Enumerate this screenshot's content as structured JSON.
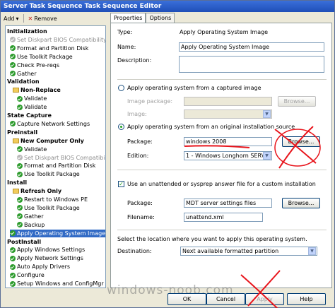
{
  "window": {
    "title": "Server Task Sequence Task Sequence Editor"
  },
  "toolbar": {
    "add_label": "Add",
    "remove_label": "Remove"
  },
  "tree": [
    {
      "label": "Initialization",
      "kind": "group"
    },
    {
      "label": "Set Diskpart BIOS Compatibility",
      "kind": "item",
      "disabled": true
    },
    {
      "label": "Format and Partition Disk",
      "kind": "item"
    },
    {
      "label": "Use Toolkit Package",
      "kind": "item"
    },
    {
      "label": "Check Pre-reqs",
      "kind": "item"
    },
    {
      "label": "Gather",
      "kind": "item"
    },
    {
      "label": "Validation",
      "kind": "group"
    },
    {
      "label": "Non-Replace",
      "kind": "subgroup"
    },
    {
      "label": "Validate",
      "kind": "item2"
    },
    {
      "label": "Validate",
      "kind": "item2"
    },
    {
      "label": "State Capture",
      "kind": "group"
    },
    {
      "label": "Capture Network Settings",
      "kind": "item"
    },
    {
      "label": "Preinstall",
      "kind": "group"
    },
    {
      "label": "New Computer Only",
      "kind": "subgroup"
    },
    {
      "label": "Validate",
      "kind": "item2"
    },
    {
      "label": "Set Diskpart BIOS Compatibi",
      "kind": "item2",
      "disabled": true
    },
    {
      "label": "Format and Partition Disk",
      "kind": "item2"
    },
    {
      "label": "Use Toolkit Package",
      "kind": "item2"
    },
    {
      "label": "Install",
      "kind": "group"
    },
    {
      "label": "Refresh Only",
      "kind": "subgroup"
    },
    {
      "label": "Restart to Windows PE",
      "kind": "item2"
    },
    {
      "label": "Use Toolkit Package",
      "kind": "item2"
    },
    {
      "label": "Gather",
      "kind": "item2"
    },
    {
      "label": "Backup",
      "kind": "item2"
    },
    {
      "label": "Apply Operating System Image",
      "kind": "item",
      "selected": true
    },
    {
      "label": "PostInstall",
      "kind": "group"
    },
    {
      "label": "Apply Windows Settings",
      "kind": "item"
    },
    {
      "label": "Apply Network Settings",
      "kind": "item"
    },
    {
      "label": "Auto Apply Drivers",
      "kind": "item"
    },
    {
      "label": "Configure",
      "kind": "item"
    },
    {
      "label": "Setup Windows and ConfigMgr",
      "kind": "item"
    }
  ],
  "tabs": [
    {
      "label": "Properties",
      "active": true
    },
    {
      "label": "Options",
      "active": false
    }
  ],
  "props": {
    "type_label": "Type:",
    "type_value": "Apply Operating System Image",
    "name_label": "Name:",
    "name_value": "Apply Operating System Image",
    "desc_label": "Description:",
    "desc_value": "",
    "captured_radio": "Apply operating system from a captured image",
    "image_package_label": "Image package:",
    "image_label": "Image:",
    "browse_label": "Browse...",
    "original_radio": "Apply operating system from an original installation source",
    "package_label": "Package:",
    "package_value": "windows 2008",
    "edition_label": "Edition:",
    "edition_value": "1 - Windows Longhorn SERV",
    "unattend_check": "Use an unattended or sysprep answer file for a custom installation",
    "unattend_package_label": "Package:",
    "unattend_package_value": "MDT server settings files",
    "filename_label": "Filename:",
    "filename_value": "unattend.xml",
    "location_text": "Select the location where you want to apply this operating system.",
    "destination_label": "Destination:",
    "destination_value": "Next available formatted partition"
  },
  "buttons": {
    "ok": "OK",
    "cancel": "Cancel",
    "apply": "Apply",
    "help": "Help"
  },
  "watermark": "windows-noob.com",
  "annotation_color": "#e8141b"
}
